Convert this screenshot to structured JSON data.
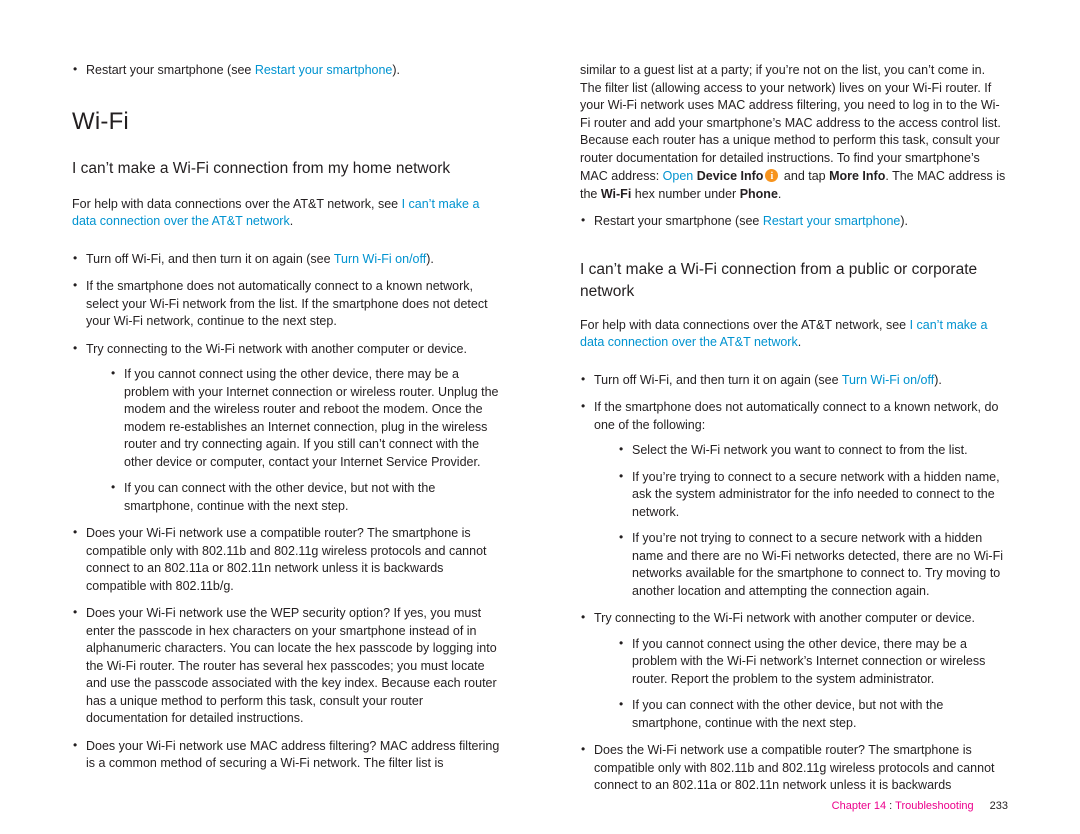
{
  "document": {
    "footer": {
      "chapter_label": "Chapter 14",
      "separator": ":",
      "topic": "Troubleshooting",
      "page_number": "233"
    }
  },
  "left_column": {
    "top_bullet": {
      "pre": "Restart your smartphone (see ",
      "link": "Restart your smartphone",
      "post": ")."
    },
    "section_title": "Wi-Fi",
    "heading1": "I can’t make a Wi-Fi connection from my home network",
    "intro": {
      "pre": "For help with data connections over the AT&T network, see ",
      "link": "I can’t make a data connection over the AT&T network",
      "post": "."
    },
    "bullets": [
      {
        "pre": "Turn off Wi-Fi, and then turn it on again (see ",
        "link": "Turn Wi-Fi on/off",
        "post": ")."
      },
      {
        "text": "If the smartphone does not automatically connect to a known network, select your Wi-Fi network from the list. If the smartphone does not detect your Wi-Fi network, continue to the next step."
      },
      {
        "text": "Try connecting to the Wi-Fi network with another computer or device.",
        "sub": [
          "If you cannot connect using the other device, there may be a problem with your Internet connection or wireless router. Unplug the modem and the wireless router and reboot the modem. Once the modem re-establishes an Internet connection, plug in the wireless router and try connecting again. If you still can’t connect with the other device or computer, contact your Internet Service Provider.",
          "If you can connect with the other device, but not with the smartphone, continue with the next step."
        ]
      },
      {
        "text": "Does your Wi-Fi network use a compatible router? The smartphone is compatible only with 802.11b and 802.11g wireless protocols and cannot connect to an 802.11a or 802.11n network unless it is backwards compatible with 802.11b/g."
      },
      {
        "text": "Does your Wi-Fi network use the WEP security option? If yes, you must enter the passcode in hex characters on your smartphone instead of in alphanumeric characters. You can locate the hex passcode by logging into the Wi-Fi router. The router has several hex passcodes; you must locate and use the passcode associated with the key index. Because each router has a unique method to perform this task, consult your router documentation for detailed instructions."
      },
      {
        "text": "Does your Wi-Fi network use MAC address filtering? MAC address filtering is a common method of securing a Wi-Fi network. The filter list is"
      }
    ]
  },
  "right_column": {
    "continued_paragraph": {
      "part1": "similar to a guest list at a party; if you’re not on the list, you can’t come in. The filter list (allowing access to your network) lives on your Wi-Fi router. If your Wi-Fi network uses MAC address filtering, you need to log in to the Wi-Fi router and add your smartphone’s MAC address to the access control list. Because each router has a unique method to perform this task, consult your router documentation for detailed instructions. To find your smartphone’s MAC address: ",
      "link_open": "Open",
      "bold_device_info": "Device Info",
      "icon": "device-info-icon",
      "part2": " and tap ",
      "bold_more_info": "More Info",
      "part3": ". The MAC address is the ",
      "bold_wifi": "Wi-Fi",
      "part4": " hex number under ",
      "bold_phone": "Phone",
      "part5": "."
    },
    "restart_bullet": {
      "pre": "Restart your smartphone (see ",
      "link": "Restart your smartphone",
      "post": ")."
    },
    "heading1": "I can’t make a Wi-Fi connection from a public or corporate network",
    "intro": {
      "pre": "For help with data connections over the AT&T network, see ",
      "link": "I can’t make a data connection over the AT&T network",
      "post": "."
    },
    "bullets": [
      {
        "pre": "Turn off Wi-Fi, and then turn it on again (see ",
        "link": "Turn Wi-Fi on/off",
        "post": ")."
      },
      {
        "text": "If the smartphone does not automatically connect to a known network, do one of the following:",
        "sub": [
          "Select the Wi-Fi network you want to connect to from the list.",
          "If you’re trying to connect to a secure network with a hidden name, ask the system administrator for the info needed to connect to the network.",
          "If you’re not trying to connect to a secure network with a hidden name and there are no Wi-Fi networks detected, there are no Wi-Fi networks available for the smartphone to connect to. Try moving to another location and attempting the connection again."
        ]
      },
      {
        "text": "Try connecting to the Wi-Fi network with another computer or device.",
        "sub": [
          "If you cannot connect using the other device, there may be a problem with the Wi-Fi network’s Internet connection or wireless router. Report the problem to the system administrator.",
          "If you can connect with the other device, but not with the smartphone, continue with the next step."
        ]
      },
      {
        "text": "Does the Wi-Fi network use a compatible router? The smartphone is compatible only with 802.11b and 802.11g wireless protocols and cannot connect to an 802.11a or 802.11n network unless it is backwards"
      }
    ]
  }
}
